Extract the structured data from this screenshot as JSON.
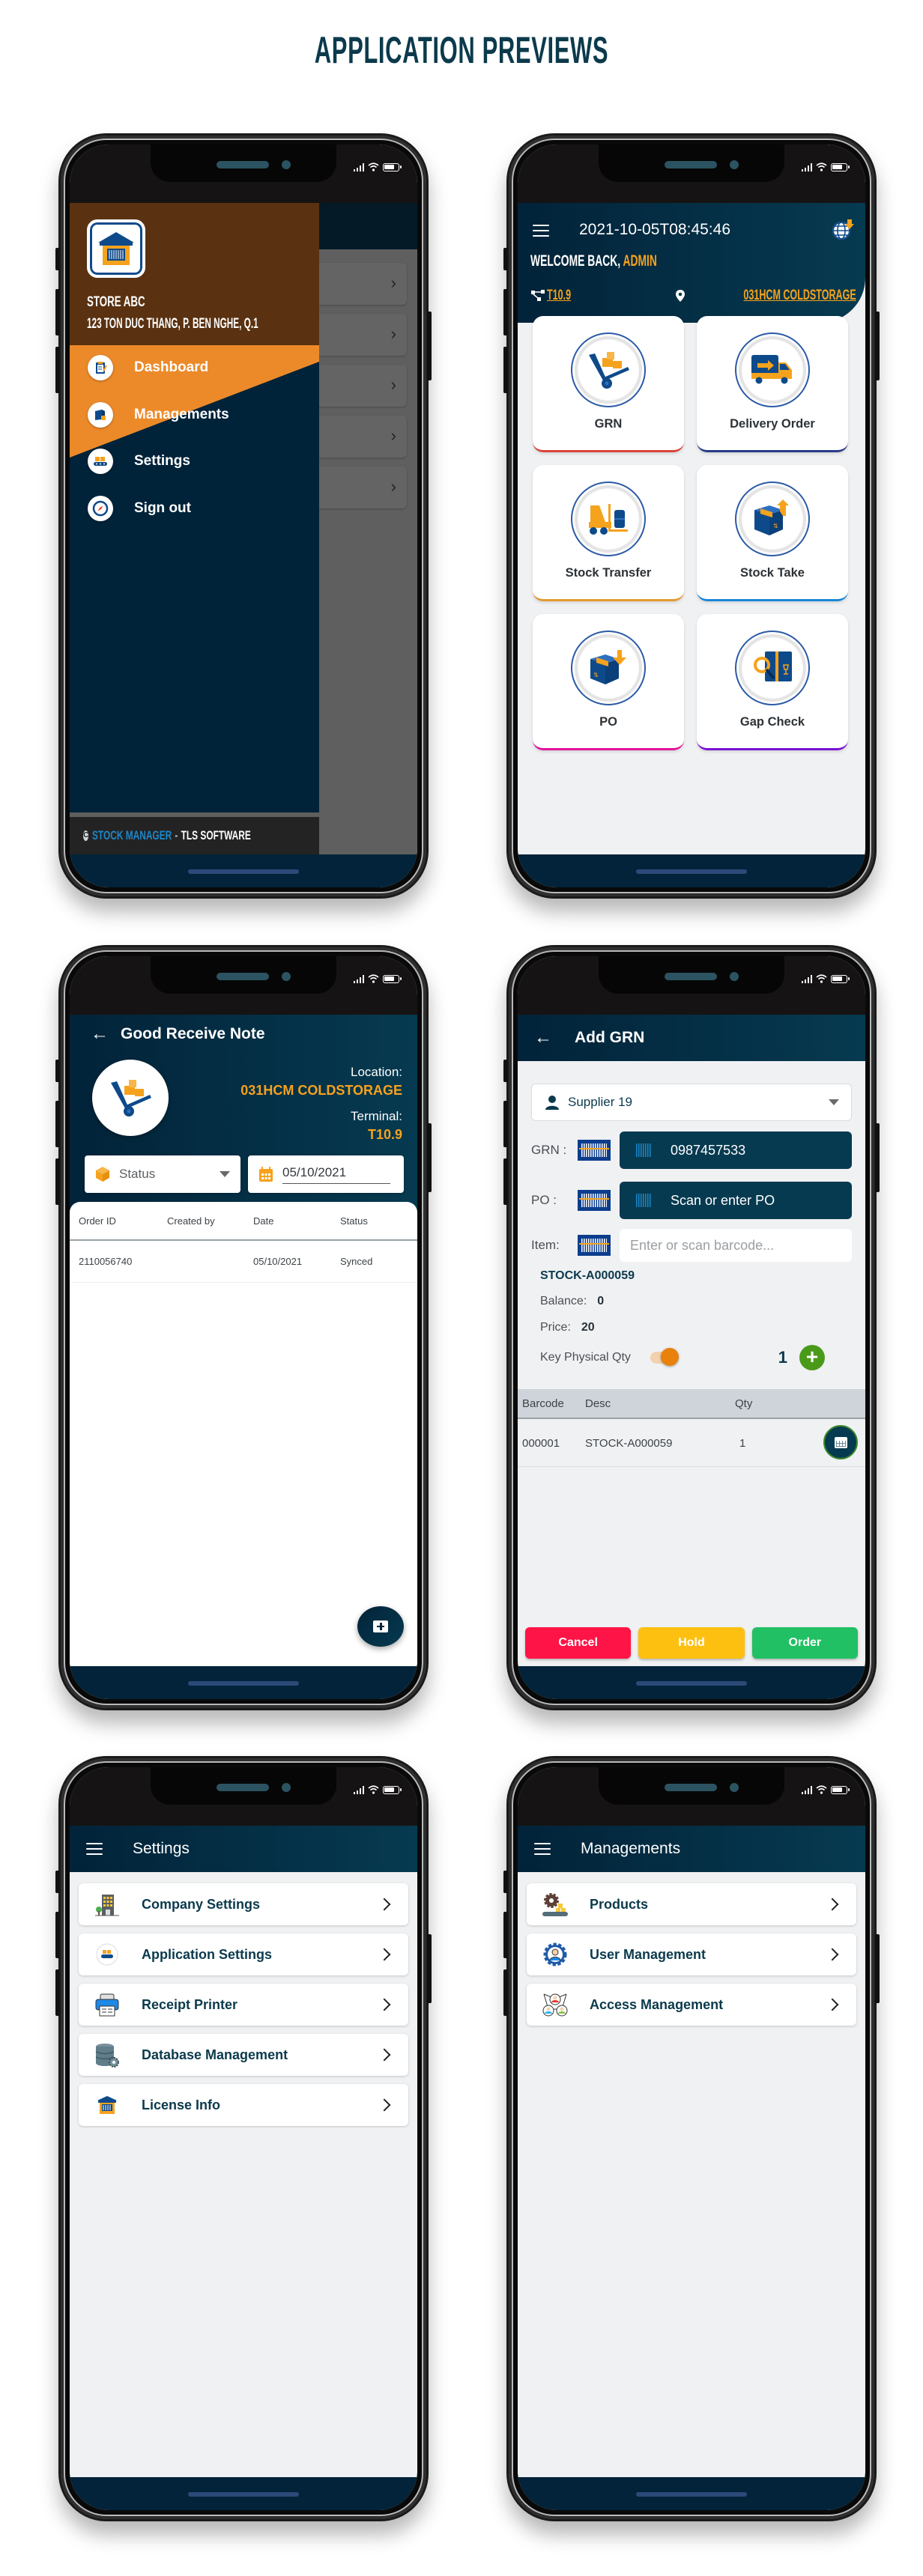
{
  "page": {
    "title": "APPLICATION PREVIEWS"
  },
  "colors": {
    "navy": "#022339",
    "teal": "#063a50",
    "orange": "#f5a21d",
    "brown": "#5a3211",
    "drawer_orange": "#ec8a2a",
    "cancel": "#ff1447",
    "hold": "#fdc010",
    "order": "#22c064"
  },
  "drawer_screen": {
    "store_name": "STORE ABC",
    "store_address": "123 TON DUC THANG, P. BEN NGHE, Q.1",
    "menu": [
      {
        "label": "Dashboard",
        "icon": "clipboard-icon"
      },
      {
        "label": "Managements",
        "icon": "box-lock-icon"
      },
      {
        "label": "Settings",
        "icon": "conveyor-icon"
      },
      {
        "label": "Sign out",
        "icon": "compass-icon"
      }
    ],
    "footer": {
      "copyright_symbol": "C",
      "brand": "STOCK MANAGER",
      "separator": "-",
      "company": "TLS SOFTWARE"
    }
  },
  "dashboard_screen": {
    "datetime": "2021-10-05T08:45:46",
    "welcome_prefix": "WELCOME BACK,",
    "user": "ADMIN",
    "terminal": "T10.9",
    "location": "031HCM COLDSTORAGE",
    "tiles": [
      {
        "label": "GRN",
        "accent": "#d9443a"
      },
      {
        "label": "Delivery Order",
        "accent": "#2a3b8a"
      },
      {
        "label": "Stock Transfer",
        "accent": "#e39a2d"
      },
      {
        "label": "Stock Take",
        "accent": "#1a86d8"
      },
      {
        "label": "PO",
        "accent": "#e0139b"
      },
      {
        "label": "Gap Check",
        "accent": "#7a12d4"
      }
    ]
  },
  "grn_list_screen": {
    "title": "Good Receive Note",
    "location_label": "Location:",
    "location_value": "031HCM COLDSTORAGE",
    "terminal_label": "Terminal:",
    "terminal_value": "T10.9",
    "status_filter": {
      "placeholder": "Status"
    },
    "date_filter": {
      "value": "05/10/2021"
    },
    "columns": [
      "Order ID",
      "Created by",
      "Date",
      "Status"
    ],
    "rows": [
      {
        "order_id": "2110056740",
        "created_by": "",
        "date": "05/10/2021",
        "status": "Synced"
      }
    ]
  },
  "add_grn_screen": {
    "title": "Add GRN",
    "supplier": "Supplier 19",
    "grn_label": "GRN :",
    "grn_value": "0987457533",
    "po_label": "PO :",
    "po_placeholder": "Scan or enter PO",
    "item_label": "Item:",
    "item_placeholder": "Enter or scan barcode...",
    "stock_code": "STOCK-A000059",
    "balance_label": "Balance:",
    "balance_value": "0",
    "price_label": "Price:",
    "price_value": "20",
    "key_physical_qty_label": "Key Physical Qty",
    "key_physical_qty_enabled": true,
    "qty_value": "1",
    "columns": [
      "Barcode",
      "Desc",
      "Qty"
    ],
    "rows": [
      {
        "barcode": "000001",
        "desc": "STOCK-A000059",
        "qty": "1"
      }
    ],
    "buttons": {
      "cancel": "Cancel",
      "hold": "Hold",
      "order": "Order"
    }
  },
  "settings_screen": {
    "title": "Settings",
    "items": [
      {
        "label": "Company Settings",
        "icon": "building-icon"
      },
      {
        "label": "Application Settings",
        "icon": "conveyor-icon"
      },
      {
        "label": "Receipt Printer",
        "icon": "printer-icon"
      },
      {
        "label": "Database Management",
        "icon": "database-gear-icon"
      },
      {
        "label": "License Info",
        "icon": "warehouse-icon"
      }
    ]
  },
  "managements_screen": {
    "title": "Managements",
    "items": [
      {
        "label": "Products",
        "icon": "gear-conveyor-icon"
      },
      {
        "label": "User Management",
        "icon": "user-gear-icon"
      },
      {
        "label": "Access Management",
        "icon": "network-users-icon"
      }
    ]
  }
}
